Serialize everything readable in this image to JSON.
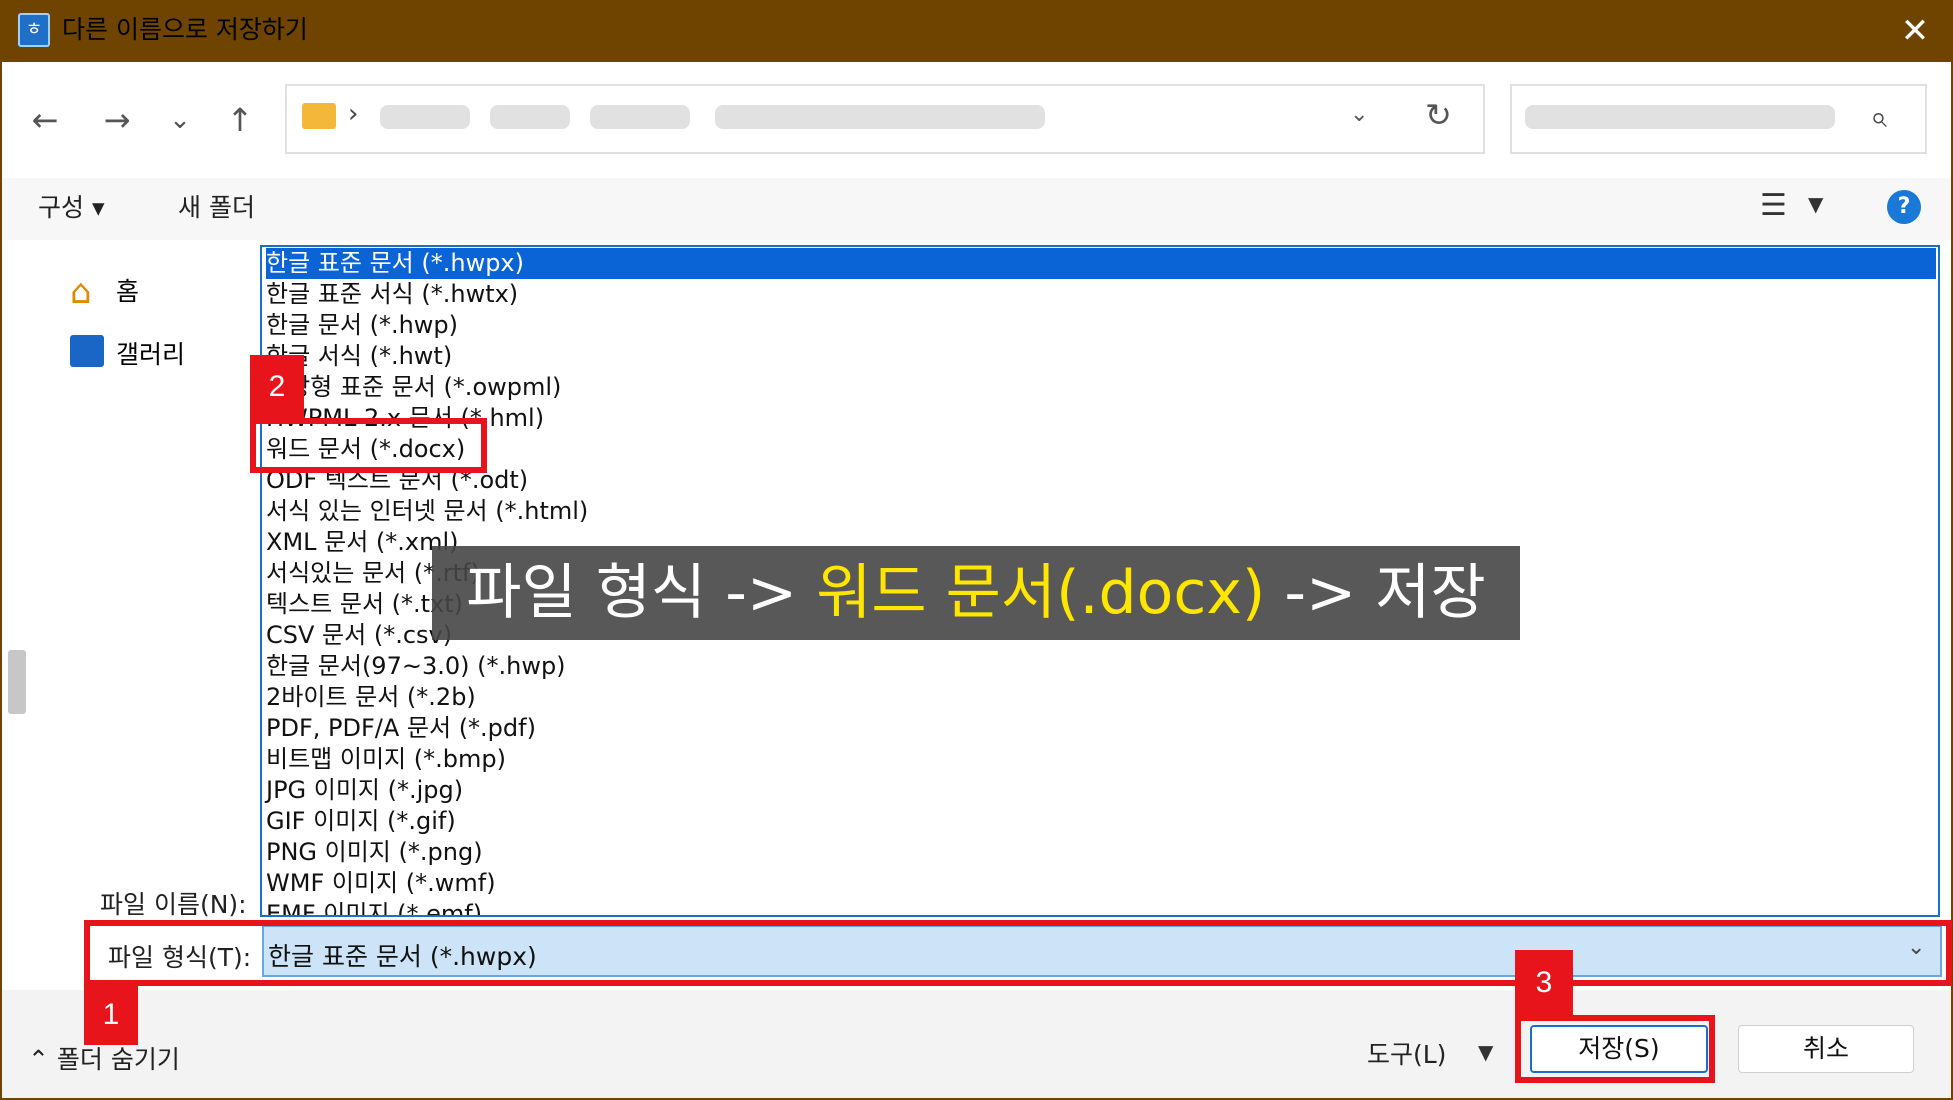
{
  "window": {
    "title": "다른 이름으로 저장하기",
    "app_icon": "hwp-app-icon",
    "close_glyph": "✕"
  },
  "nav": {
    "back": "←",
    "forward": "→",
    "recent": "⌄",
    "up": "↑",
    "address_sep": "›",
    "refresh": "↻",
    "search_glyph": "⌕"
  },
  "toolbar": {
    "organize": "구성 ▾",
    "new_folder": "새 폴더",
    "help": "?"
  },
  "sidebar": {
    "items": [
      {
        "label": "홈",
        "icon": "home-icon"
      },
      {
        "label": "갤러리",
        "icon": "gallery-icon"
      }
    ]
  },
  "filetypes": [
    "한글 표준 문서 (*.hwpx)",
    "한글 표준 서식 (*.hwtx)",
    "한글 문서 (*.hwp)",
    "한글 서식 (*.hwt)",
    "개방형 표준 문서 (*.owpml)",
    "HWPML 2.x 문서 (*.hml)",
    "워드 문서 (*.docx)",
    "ODF 텍스트 문서 (*.odt)",
    "서식 있는 인터넷 문서 (*.html)",
    "XML 문서 (*.xml)",
    "서식있는 문서 (*.rtf)",
    "텍스트 문서 (*.txt)",
    "CSV 문서 (*.csv)",
    "한글 문서(97~3.0) (*.hwp)",
    "2바이트 문서 (*.2b)",
    "PDF, PDF/A 문서 (*.pdf)",
    "비트맵 이미지 (*.bmp)",
    "JPG 이미지 (*.jpg)",
    "GIF 이미지 (*.gif)",
    "PNG 이미지 (*.png)",
    "WMF 이미지 (*.wmf)",
    "EMF 이미지 (*.emf)"
  ],
  "selected_index": 0,
  "fields": {
    "filename_label": "파일 이름(N):",
    "filetype_label": "파일 형식(T):",
    "filetype_value": "한글 표준 문서 (*.hwpx)"
  },
  "bottom": {
    "hide_folders": "⌃ 폴더 숨기기",
    "tools": "도구(L)",
    "save": "저장(S)",
    "cancel": "취소"
  },
  "annotations": {
    "badge1": "1",
    "badge2": "2",
    "badge3": "3",
    "caption_pre": "파일 형식 -> ",
    "caption_hl": "워드 문서(.docx)",
    "caption_post": " -> 저장"
  }
}
